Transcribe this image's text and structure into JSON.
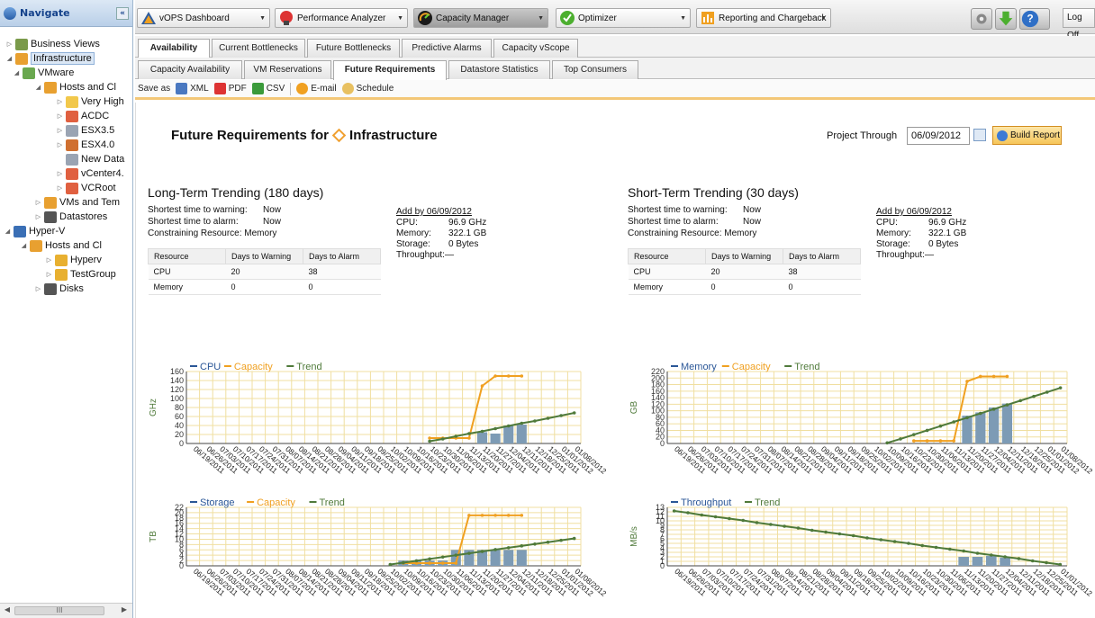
{
  "nav": {
    "title": "Navigate",
    "collapse_label": "«",
    "tree": [
      {
        "label": "Business Views",
        "icon": "business-views-icon",
        "toggle": "▷",
        "color": "#7a9a4a"
      },
      {
        "label": "Infrastructure",
        "icon": "infrastructure-icon",
        "toggle": "◢",
        "color": "#e8a030",
        "selected": true
      },
      {
        "label": "VMware",
        "icon": "vmware-icon",
        "toggle": "◢",
        "color": "#6aa84f"
      },
      {
        "label": "Hosts and Cl",
        "icon": "hosts-clusters-icon",
        "toggle": "◢",
        "color": "#e8a030"
      },
      {
        "label": "Very High",
        "icon": "folder-icon",
        "toggle": "▷",
        "color": "#f2c84b"
      },
      {
        "label": "ACDC",
        "icon": "datacenter-icon",
        "toggle": "▷",
        "color": "#e06040"
      },
      {
        "label": "ESX3.5",
        "icon": "host-icon",
        "toggle": "▷",
        "color": "#9aa4b3"
      },
      {
        "label": "ESX4.0",
        "icon": "host-icon",
        "toggle": "▷",
        "color": "#d07030"
      },
      {
        "label": "New Data",
        "icon": "host-icon",
        "toggle": "",
        "color": "#9aa4b3"
      },
      {
        "label": "vCenter4.",
        "icon": "vcenter-icon",
        "toggle": "▷",
        "color": "#e06040"
      },
      {
        "label": "VCRoot",
        "icon": "vcenter-icon",
        "toggle": "▷",
        "color": "#e06040"
      },
      {
        "label": "VMs and Tem",
        "icon": "vms-icon",
        "toggle": "▷",
        "color": "#e8a030"
      },
      {
        "label": "Datastores",
        "icon": "datastores-icon",
        "toggle": "▷",
        "color": "#555"
      },
      {
        "label": "Hyper-V",
        "icon": "hyperv-icon",
        "toggle": "◢",
        "color": "#3a6fb5"
      },
      {
        "label": "Hosts and Cl",
        "icon": "hosts-clusters-icon",
        "toggle": "◢",
        "color": "#e8a030"
      },
      {
        "label": "Hyperv",
        "icon": "hyperv-host-icon",
        "toggle": "▷",
        "color": "#e8b030"
      },
      {
        "label": "TestGroup",
        "icon": "hyperv-host-icon",
        "toggle": "▷",
        "color": "#e8b030"
      },
      {
        "label": "Disks",
        "icon": "disks-icon",
        "toggle": "▷",
        "color": "#555"
      }
    ],
    "scroll_label": "III"
  },
  "toolbar": {
    "apps": [
      {
        "label": "vOPS Dashboard",
        "icon": "vops-dashboard-icon",
        "color": "#2f5d9e"
      },
      {
        "label": "Performance Analyzer",
        "icon": "performance-analyzer-icon",
        "color": "#d33"
      },
      {
        "label": "Capacity Manager",
        "icon": "capacity-manager-icon",
        "color": "#1a1a1a"
      },
      {
        "label": "Optimizer",
        "icon": "optimizer-icon",
        "color": "#4caf2f"
      },
      {
        "label": "Reporting and Chargeback",
        "icon": "reporting-chargeback-icon",
        "color": "#f0a020"
      }
    ],
    "logoff": "Log Off"
  },
  "tabs1": [
    "Availability",
    "Current Bottlenecks",
    "Future Bottlenecks",
    "Predictive Alarms",
    "Capacity vScope"
  ],
  "tabs2": [
    "Capacity Availability",
    "VM Reservations",
    "Future Requirements",
    "Datastore Statistics",
    "Top Consumers"
  ],
  "savebar": {
    "label": "Save as",
    "items": [
      "XML",
      "PDF",
      "CSV",
      "E-mail",
      "Schedule"
    ]
  },
  "page": {
    "title_prefix": "Future Requirements for",
    "title_target": "Infrastructure",
    "project_label": "Project Through",
    "project_date": "06/09/2012",
    "build": "Build Report"
  },
  "long": {
    "title": "Long-Term Trending (180 days)",
    "warn_label": "Shortest time to warning:",
    "warn_value": "Now",
    "alarm_label": "Shortest time to alarm:",
    "alarm_value": "Now",
    "constraint_label": "Constraining Resource:",
    "constraint_value": "Memory",
    "add_by": "Add by 06/09/2012",
    "cpu_label": "CPU:",
    "cpu_value": "96.9 GHz",
    "mem_label": "Memory:",
    "mem_value": "322.1 GB",
    "storage_label": "Storage:",
    "storage_value": "0 Bytes",
    "throughput_label": "Throughput:",
    "throughput_value": "—",
    "table": {
      "headers": [
        "Resource",
        "Days to Warning",
        "Days to Alarm"
      ],
      "rows": [
        [
          "CPU",
          "20",
          "38"
        ],
        [
          "Memory",
          "0",
          "0"
        ]
      ]
    }
  },
  "short": {
    "title": "Short-Term Trending (30 days)",
    "warn_label": "Shortest time to warning:",
    "warn_value": "Now",
    "alarm_label": "Shortest time to alarm:",
    "alarm_value": "Now",
    "constraint_label": "Constraining Resource:",
    "constraint_value": "Memory",
    "add_by": "Add by 06/09/2012",
    "cpu_label": "CPU:",
    "cpu_value": "96.9 GHz",
    "mem_label": "Memory:",
    "mem_value": "322.1 GB",
    "storage_label": "Storage:",
    "storage_value": "0 Bytes",
    "throughput_label": "Throughput:",
    "throughput_value": "—",
    "table": {
      "headers": [
        "Resource",
        "Days to Warning",
        "Days to Alarm"
      ],
      "rows": [
        [
          "CPU",
          "20",
          "38"
        ],
        [
          "Memory",
          "0",
          "0"
        ]
      ]
    }
  },
  "colors": {
    "series": "#2b5797",
    "capacity": "#f0a020",
    "trend": "#4f7a3a",
    "bar": "#7d9bb5",
    "grid": "#f0dfa0"
  },
  "chart_data": [
    {
      "type": "bar",
      "id": "cpu",
      "ylabel": "GHz",
      "ylim": [
        0,
        160
      ],
      "yticks": [
        0,
        20,
        40,
        60,
        80,
        100,
        120,
        140,
        160
      ],
      "x": [
        "06/19/2011",
        "06/26/2011",
        "07/03/2011",
        "07/10/2011",
        "07/17/2011",
        "07/24/2011",
        "07/31/2011",
        "08/07/2011",
        "08/14/2011",
        "08/21/2011",
        "08/28/2011",
        "09/04/2011",
        "09/11/2011",
        "09/18/2011",
        "09/25/2011",
        "10/02/2011",
        "10/09/2011",
        "10/16/2011",
        "10/23/2011",
        "10/30/2011",
        "11/06/2011",
        "11/13/2011",
        "11/20/2011",
        "11/27/2011",
        "12/04/2011",
        "12/11/2011",
        "12/18/2011",
        "12/25/2011",
        "01/01/2012",
        "01/08/2012"
      ],
      "legend": [
        "CPU",
        "Capacity",
        "Trend"
      ],
      "bars": [
        null,
        null,
        null,
        null,
        null,
        null,
        null,
        null,
        null,
        null,
        null,
        null,
        null,
        null,
        null,
        null,
        null,
        null,
        null,
        null,
        null,
        null,
        25,
        22,
        40,
        42,
        null,
        null,
        null,
        null
      ],
      "capacity": [
        null,
        null,
        null,
        null,
        null,
        null,
        null,
        null,
        null,
        null,
        null,
        null,
        null,
        null,
        null,
        null,
        null,
        null,
        12,
        12,
        12,
        12,
        128,
        150,
        150,
        150,
        null,
        null,
        null,
        null
      ],
      "trend": [
        null,
        null,
        null,
        null,
        null,
        null,
        null,
        null,
        null,
        null,
        null,
        null,
        null,
        null,
        null,
        null,
        null,
        null,
        5,
        10,
        16,
        22,
        27,
        33,
        39,
        45,
        50,
        56,
        62,
        68
      ]
    },
    {
      "type": "bar",
      "id": "memory",
      "ylabel": "GB",
      "ylim": [
        0,
        220
      ],
      "yticks": [
        0,
        20,
        40,
        60,
        80,
        100,
        120,
        140,
        160,
        180,
        200,
        220
      ],
      "x": [
        "06/19/2011",
        "06/26/2011",
        "07/03/2011",
        "07/10/2011",
        "07/17/2011",
        "07/24/2011",
        "07/31/2011",
        "08/07/2011",
        "08/14/2011",
        "08/21/2011",
        "08/28/2011",
        "09/04/2011",
        "09/11/2011",
        "09/18/2011",
        "09/25/2011",
        "10/02/2011",
        "10/09/2011",
        "10/16/2011",
        "10/23/2011",
        "10/30/2011",
        "11/06/2011",
        "11/13/2011",
        "11/20/2011",
        "11/27/2011",
        "12/04/2011",
        "12/11/2011",
        "12/18/2011",
        "12/25/2011",
        "01/01/2012",
        "01/08/2012"
      ],
      "legend": [
        "Memory",
        "Capacity",
        "Trend"
      ],
      "bars": [
        null,
        null,
        null,
        null,
        null,
        null,
        null,
        null,
        null,
        null,
        null,
        null,
        null,
        null,
        null,
        null,
        null,
        null,
        null,
        null,
        null,
        null,
        85,
        95,
        110,
        122,
        null,
        null,
        null,
        null
      ],
      "capacity": [
        null,
        null,
        null,
        null,
        null,
        null,
        null,
        null,
        null,
        null,
        null,
        null,
        null,
        null,
        null,
        null,
        null,
        null,
        8,
        8,
        8,
        8,
        190,
        205,
        205,
        205,
        null,
        null,
        null,
        null
      ],
      "trend": [
        null,
        null,
        null,
        null,
        null,
        null,
        null,
        null,
        null,
        null,
        null,
        null,
        null,
        null,
        null,
        null,
        2,
        14,
        27,
        40,
        53,
        66,
        79,
        92,
        105,
        118,
        131,
        144,
        157,
        170
      ]
    },
    {
      "type": "bar",
      "id": "storage",
      "ylabel": "TB",
      "ylim": [
        0,
        22
      ],
      "yticks": [
        0,
        2,
        4,
        6,
        8,
        10,
        12,
        14,
        16,
        18,
        20,
        22
      ],
      "x": [
        "06/19/2011",
        "06/26/2011",
        "07/03/2011",
        "07/10/2011",
        "07/17/2011",
        "07/24/2011",
        "07/31/2011",
        "08/07/2011",
        "08/14/2011",
        "08/21/2011",
        "08/28/2011",
        "09/04/2011",
        "09/11/2011",
        "09/18/2011",
        "09/25/2011",
        "10/02/2011",
        "10/09/2011",
        "10/16/2011",
        "10/23/2011",
        "10/30/2011",
        "11/06/2011",
        "11/13/2011",
        "11/20/2011",
        "11/27/2011",
        "12/04/2011",
        "12/11/2011",
        "12/18/2011",
        "12/25/2011",
        "01/01/2012",
        "01/08/2012"
      ],
      "legend": [
        "Storage",
        "Capacity",
        "Trend"
      ],
      "bars": [
        null,
        null,
        null,
        null,
        null,
        null,
        null,
        null,
        null,
        null,
        null,
        null,
        null,
        null,
        null,
        null,
        2,
        2,
        2,
        2,
        6,
        6,
        6,
        6,
        6,
        6,
        null,
        null,
        null,
        null
      ],
      "capacity": [
        null,
        null,
        null,
        null,
        null,
        null,
        null,
        null,
        null,
        null,
        null,
        null,
        null,
        null,
        null,
        null,
        1,
        1,
        1,
        1,
        1,
        19,
        19,
        19,
        19,
        19,
        null,
        null,
        null,
        null
      ],
      "trend": [
        null,
        null,
        null,
        null,
        null,
        null,
        null,
        null,
        null,
        null,
        null,
        null,
        null,
        null,
        null,
        0.5,
        1.2,
        1.9,
        2.6,
        3.3,
        4,
        4.7,
        5.4,
        6.1,
        6.8,
        7.5,
        8.2,
        8.9,
        9.6,
        10.3
      ]
    },
    {
      "type": "bar",
      "id": "throughput",
      "ylabel": "MB/s",
      "ylim": [
        0,
        13
      ],
      "yticks": [
        0,
        1,
        2,
        3,
        4,
        5,
        6,
        7,
        8,
        9,
        10,
        11,
        12,
        13
      ],
      "x": [
        "06/19/2011",
        "06/26/2011",
        "07/03/2011",
        "07/10/2011",
        "07/17/2011",
        "07/24/2011",
        "07/31/2011",
        "08/07/2011",
        "08/14/2011",
        "08/21/2011",
        "08/28/2011",
        "09/04/2011",
        "09/11/2011",
        "09/18/2011",
        "09/25/2011",
        "10/02/2011",
        "10/09/2011",
        "10/16/2011",
        "10/23/2011",
        "10/30/2011",
        "11/06/2011",
        "11/13/2011",
        "11/20/2011",
        "11/27/2011",
        "12/04/2011",
        "12/11/2011",
        "12/18/2011",
        "12/25/2011",
        "01/01/2012"
      ],
      "legend": [
        "Throughput",
        "Trend"
      ],
      "bars": [
        null,
        null,
        null,
        null,
        null,
        null,
        null,
        null,
        null,
        null,
        null,
        null,
        null,
        null,
        null,
        null,
        null,
        null,
        null,
        null,
        null,
        2,
        2,
        2.2,
        1.8,
        null,
        null,
        null,
        null
      ],
      "capacity": null,
      "trend": [
        12.2,
        11.8,
        11.3,
        10.9,
        10.5,
        10.1,
        9.6,
        9.2,
        8.8,
        8.4,
        7.9,
        7.5,
        7.1,
        6.7,
        6.2,
        5.8,
        5.4,
        5,
        4.5,
        4.1,
        3.7,
        3.3,
        2.8,
        2.4,
        2,
        1.6,
        1.1,
        0.7,
        0.3
      ]
    }
  ]
}
